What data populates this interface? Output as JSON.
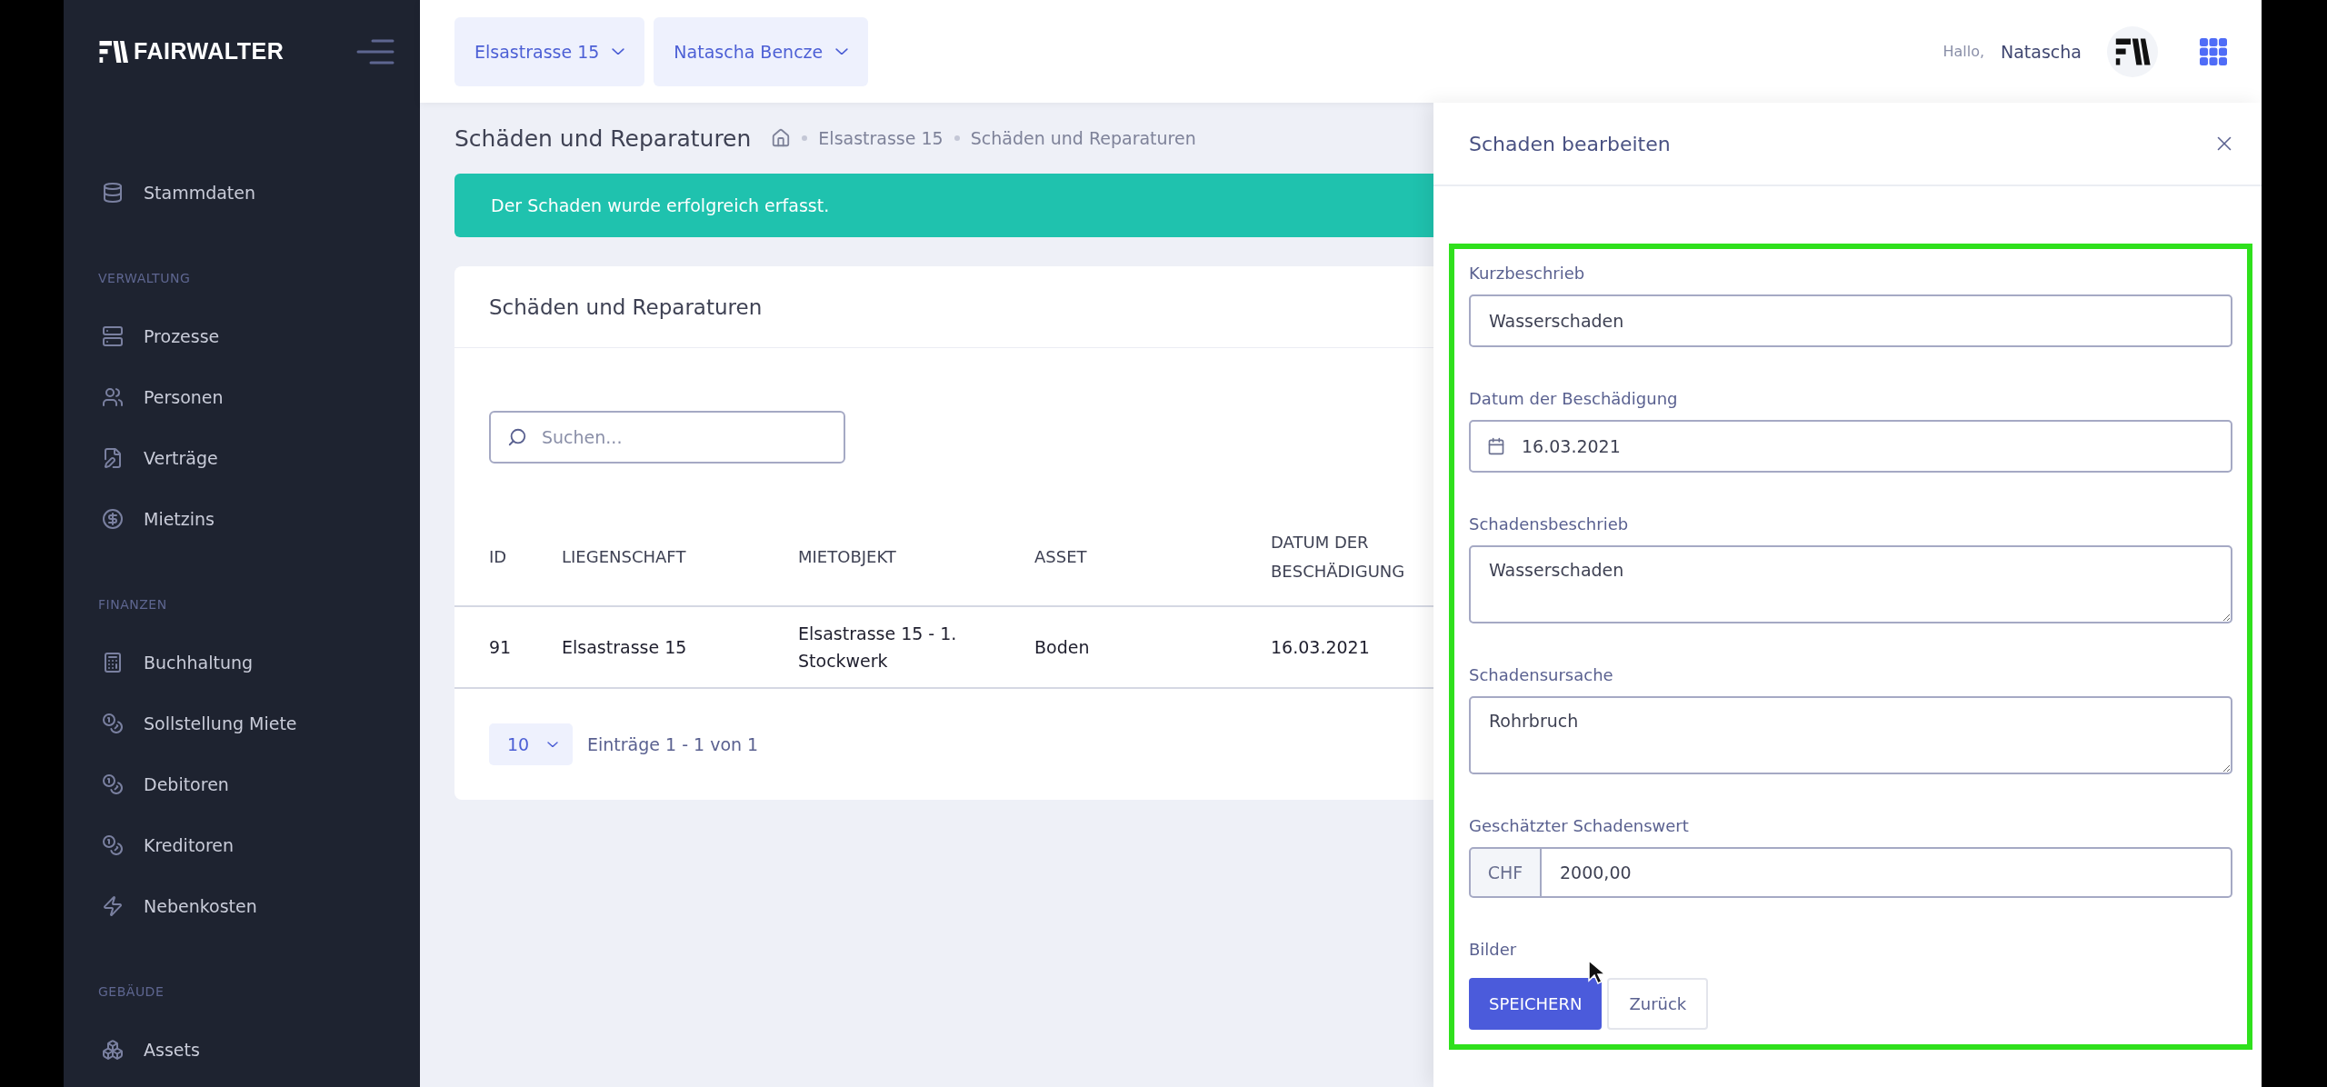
{
  "topbar": {
    "selectors": [
      {
        "label": "Elsastrasse 15"
      },
      {
        "label": "Natascha Bencze"
      }
    ],
    "greeting": "Hallo,",
    "user_name": "Natascha"
  },
  "sidebar": {
    "logo": "FAIRWALTER",
    "items": [
      {
        "kind": "link",
        "label": "Stammdaten"
      },
      {
        "kind": "heading",
        "label": "VERWALTUNG"
      },
      {
        "kind": "link",
        "label": "Prozesse"
      },
      {
        "kind": "link",
        "label": "Personen"
      },
      {
        "kind": "link",
        "label": "Verträge"
      },
      {
        "kind": "link",
        "label": "Mietzins"
      },
      {
        "kind": "heading",
        "label": "FINANZEN"
      },
      {
        "kind": "link",
        "label": "Buchhaltung"
      },
      {
        "kind": "link",
        "label": "Sollstellung Miete"
      },
      {
        "kind": "link",
        "label": "Debitoren"
      },
      {
        "kind": "link",
        "label": "Kreditoren"
      },
      {
        "kind": "link",
        "label": "Nebenkosten"
      },
      {
        "kind": "heading",
        "label": "GEBÄUDE"
      },
      {
        "kind": "link",
        "label": "Assets"
      }
    ]
  },
  "page": {
    "title": "Schäden und Reparaturen",
    "breadcrumb": [
      "Elsastrasse 15",
      "Schäden und Reparaturen"
    ],
    "alert": "Der Schaden wurde erfolgreich erfasst.",
    "card": {
      "title": "Schäden und Reparaturen",
      "search": {
        "placeholder": "Suchen..."
      },
      "table": {
        "columns": [
          "ID",
          "LIEGENSCHAFT",
          "MIETOBJEKT",
          "ASSET",
          "DATUM DER BESCHÄDIGUNG"
        ],
        "rows": [
          [
            "91",
            "Elsastrasse 15",
            "Elsastrasse 15 - 1. Stockwerk",
            "Boden",
            "16.03.2021"
          ]
        ]
      },
      "pagination": {
        "page_size": "10",
        "summary": "Einträge 1 - 1 von 1"
      }
    }
  },
  "panel": {
    "title": "Schaden bearbeiten",
    "fields": [
      {
        "kind": "text",
        "label": "Kurzbeschrieb",
        "value": "Wasserschaden"
      },
      {
        "kind": "date",
        "label": "Datum der Beschädigung",
        "value": "16.03.2021"
      },
      {
        "kind": "textarea",
        "label": "Schadensbeschrieb",
        "value": "Wasserschaden"
      },
      {
        "kind": "textarea",
        "label": "Schadensursache",
        "value": "Rohrbruch"
      },
      {
        "kind": "currency",
        "label": "Geschätzter Schadenswert",
        "prefix": "CHF",
        "value": "2000,00"
      },
      {
        "kind": "upload",
        "label": "Bilder"
      }
    ],
    "buttons": [
      {
        "kind": "primary",
        "label": "SPEICHERN"
      },
      {
        "kind": "secondary",
        "label": "Zurück"
      }
    ]
  }
}
